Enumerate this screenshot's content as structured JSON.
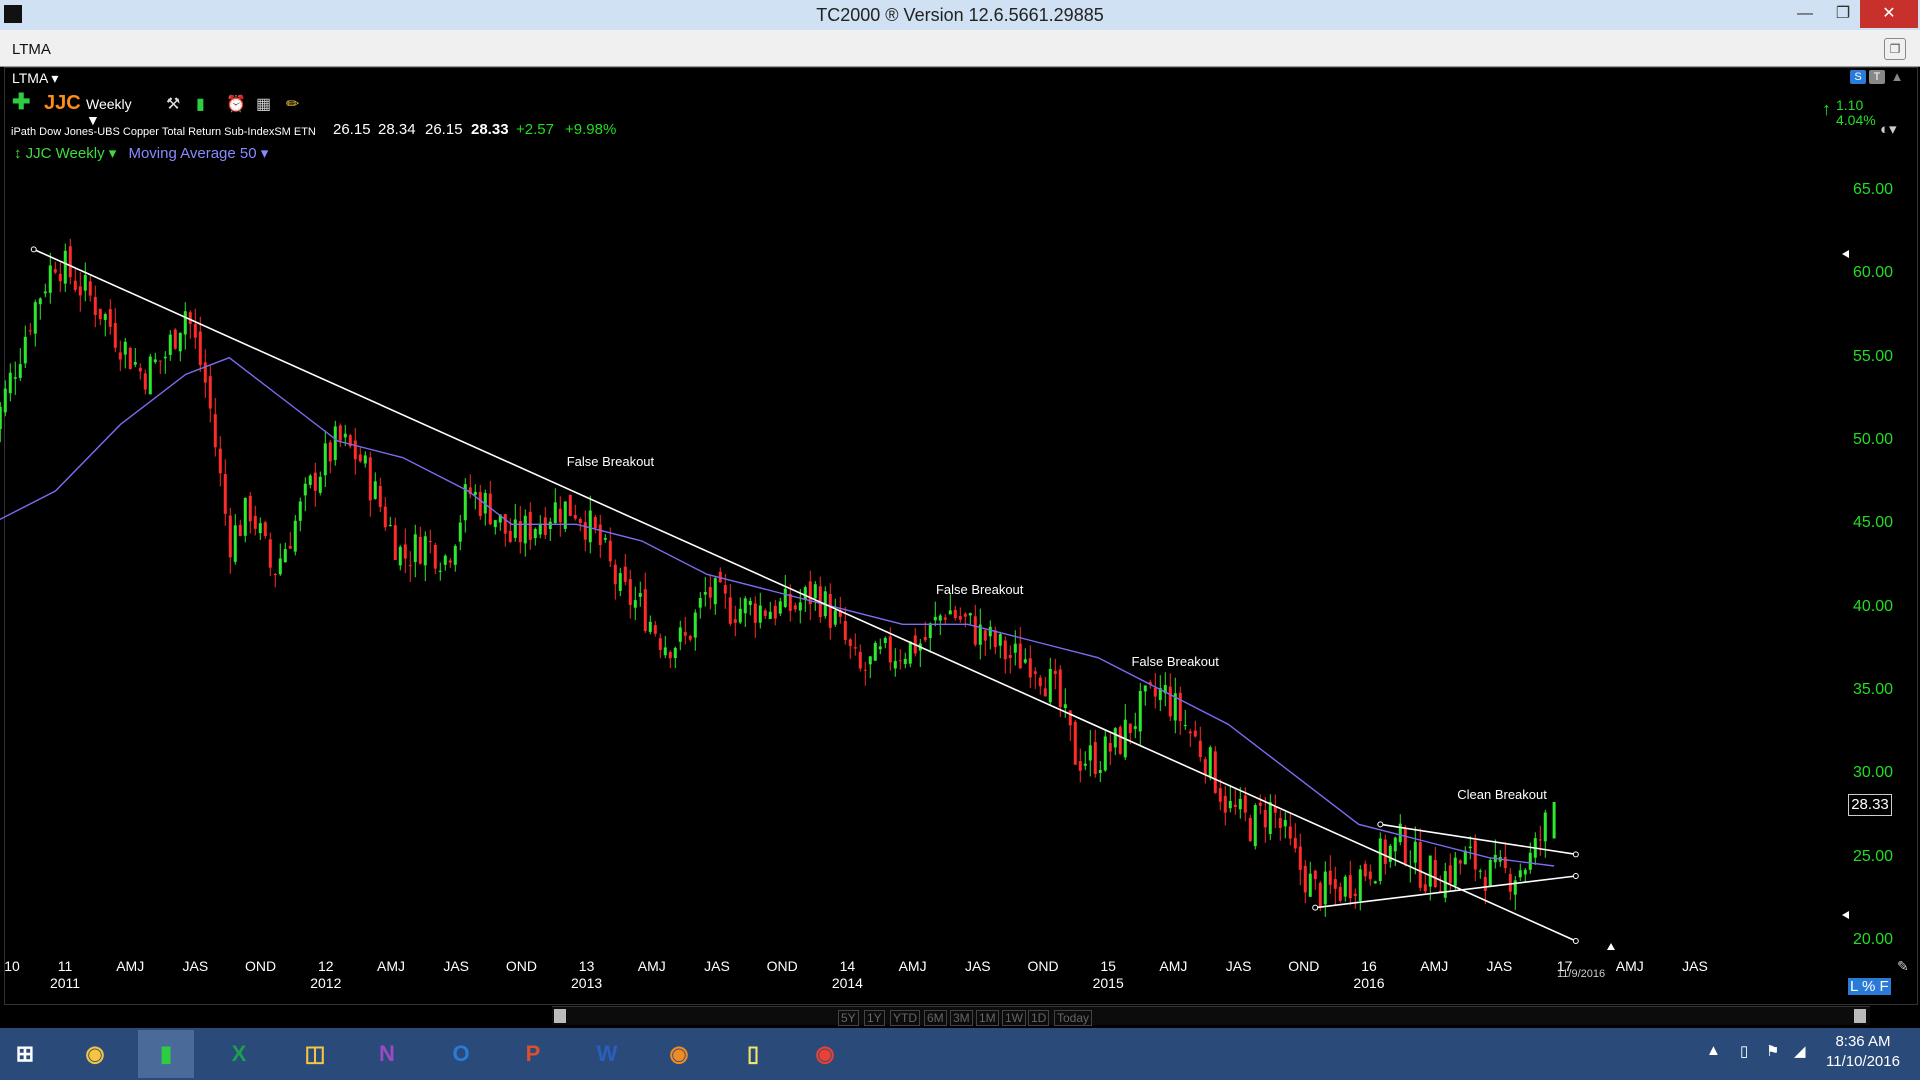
{
  "window": {
    "title": "TC2000 ® Version 12.6.5661.29885",
    "tab": "LTMA",
    "layout_name": "LTMA"
  },
  "toolbar": {
    "symbol": "JJC",
    "interval": "Weekly"
  },
  "security": {
    "name": "iPath Dow Jones-UBS Copper Total Return Sub-IndexSM ETN",
    "open": "26.15",
    "high": "28.34",
    "low": "26.15",
    "close": "28.33",
    "change": "+2.57",
    "change_pct": "+9.98%"
  },
  "legend": {
    "price_series": "JJC Weekly",
    "indicator": "Moving Average 50"
  },
  "right_info": {
    "line1": "1.10",
    "line2": "4.04%"
  },
  "right_toggles": [
    "S",
    "T"
  ],
  "scale_buttons": "L % F",
  "last_price_tag": "28.33",
  "date_stamp": "11/9/2016",
  "y_labels": [
    "65.00",
    "60.00",
    "55.00",
    "50.00",
    "45.00",
    "40.00",
    "35.00",
    "30.00",
    "25.00",
    "20.00"
  ],
  "x_labels": [
    {
      "t": "10",
      "s": ""
    },
    {
      "t": "11",
      "s": "2011"
    },
    {
      "t": "AMJ",
      "s": ""
    },
    {
      "t": "JAS",
      "s": ""
    },
    {
      "t": "OND",
      "s": ""
    },
    {
      "t": "12",
      "s": "2012"
    },
    {
      "t": "AMJ",
      "s": ""
    },
    {
      "t": "JAS",
      "s": ""
    },
    {
      "t": "OND",
      "s": ""
    },
    {
      "t": "13",
      "s": "2013"
    },
    {
      "t": "AMJ",
      "s": ""
    },
    {
      "t": "JAS",
      "s": ""
    },
    {
      "t": "OND",
      "s": ""
    },
    {
      "t": "14",
      "s": "2014"
    },
    {
      "t": "AMJ",
      "s": ""
    },
    {
      "t": "JAS",
      "s": ""
    },
    {
      "t": "OND",
      "s": ""
    },
    {
      "t": "15",
      "s": "2015"
    },
    {
      "t": "AMJ",
      "s": ""
    },
    {
      "t": "JAS",
      "s": ""
    },
    {
      "t": "OND",
      "s": ""
    },
    {
      "t": "16",
      "s": "2016"
    },
    {
      "t": "AMJ",
      "s": ""
    },
    {
      "t": "JAS",
      "s": ""
    },
    {
      "t": "17",
      "s": ""
    },
    {
      "t": "AMJ",
      "s": ""
    },
    {
      "t": "JAS",
      "s": ""
    }
  ],
  "annotations": [
    {
      "text": "False Breakout"
    },
    {
      "text": "False Breakout"
    },
    {
      "text": "False Breakout"
    },
    {
      "text": "Clean Breakout"
    }
  ],
  "timeframes": [
    "5Y",
    "1Y",
    "YTD",
    "6M",
    "3M",
    "1M",
    "1W",
    "1D",
    "Today"
  ],
  "chart_data": {
    "type": "candlestick",
    "series_name": "JJC Weekly",
    "indicator": "Moving Average 50",
    "ylim": [
      18.5,
      68
    ],
    "x_start": "2010-11",
    "x_end": "2017-10",
    "close_path": [
      {
        "date": "2010-11",
        "price": 50
      },
      {
        "date": "2011-01",
        "price": 58
      },
      {
        "date": "2011-02",
        "price": 61
      },
      {
        "date": "2011-04",
        "price": 58
      },
      {
        "date": "2011-06",
        "price": 54
      },
      {
        "date": "2011-07",
        "price": 55
      },
      {
        "date": "2011-08",
        "price": 58
      },
      {
        "date": "2011-09",
        "price": 53
      },
      {
        "date": "2011-10",
        "price": 44
      },
      {
        "date": "2011-11",
        "price": 46
      },
      {
        "date": "2011-12",
        "price": 42
      },
      {
        "date": "2012-02",
        "price": 48
      },
      {
        "date": "2012-03",
        "price": 50
      },
      {
        "date": "2012-04",
        "price": 49
      },
      {
        "date": "2012-05",
        "price": 46
      },
      {
        "date": "2012-06",
        "price": 43
      },
      {
        "date": "2012-07",
        "price": 44
      },
      {
        "date": "2012-08",
        "price": 43
      },
      {
        "date": "2012-09",
        "price": 47
      },
      {
        "date": "2012-10",
        "price": 46
      },
      {
        "date": "2012-11",
        "price": 44
      },
      {
        "date": "2013-01",
        "price": 46
      },
      {
        "date": "2013-02",
        "price": 46
      },
      {
        "date": "2013-03",
        "price": 44
      },
      {
        "date": "2013-04",
        "price": 41
      },
      {
        "date": "2013-05",
        "price": 40
      },
      {
        "date": "2013-06",
        "price": 38
      },
      {
        "date": "2013-07",
        "price": 38
      },
      {
        "date": "2013-08",
        "price": 41
      },
      {
        "date": "2013-09",
        "price": 40
      },
      {
        "date": "2013-10",
        "price": 40
      },
      {
        "date": "2013-12",
        "price": 40
      },
      {
        "date": "2014-01",
        "price": 41
      },
      {
        "date": "2014-02",
        "price": 39
      },
      {
        "date": "2014-03",
        "price": 36
      },
      {
        "date": "2014-04",
        "price": 37
      },
      {
        "date": "2014-06",
        "price": 38
      },
      {
        "date": "2014-07",
        "price": 40
      },
      {
        "date": "2014-08",
        "price": 39
      },
      {
        "date": "2014-09",
        "price": 38
      },
      {
        "date": "2014-10",
        "price": 37
      },
      {
        "date": "2014-11",
        "price": 37
      },
      {
        "date": "2014-12",
        "price": 35
      },
      {
        "date": "2015-01",
        "price": 31
      },
      {
        "date": "2015-02",
        "price": 31
      },
      {
        "date": "2015-03",
        "price": 32
      },
      {
        "date": "2015-04",
        "price": 34
      },
      {
        "date": "2015-05",
        "price": 35
      },
      {
        "date": "2015-06",
        "price": 33
      },
      {
        "date": "2015-07",
        "price": 31
      },
      {
        "date": "2015-08",
        "price": 28
      },
      {
        "date": "2015-09",
        "price": 27
      },
      {
        "date": "2015-10",
        "price": 28
      },
      {
        "date": "2015-11",
        "price": 25
      },
      {
        "date": "2015-12",
        "price": 23
      },
      {
        "date": "2016-01",
        "price": 23
      },
      {
        "date": "2016-02",
        "price": 24
      },
      {
        "date": "2016-03",
        "price": 25
      },
      {
        "date": "2016-04",
        "price": 26
      },
      {
        "date": "2016-05",
        "price": 24
      },
      {
        "date": "2016-06",
        "price": 24
      },
      {
        "date": "2016-07",
        "price": 25
      },
      {
        "date": "2016-08",
        "price": 24
      },
      {
        "date": "2016-09",
        "price": 24
      },
      {
        "date": "2016-10",
        "price": 25
      },
      {
        "date": "2016-11",
        "price": 28.33
      }
    ],
    "moving_average_path": [
      {
        "date": "2010-11",
        "price": 45
      },
      {
        "date": "2011-02",
        "price": 47
      },
      {
        "date": "2011-05",
        "price": 51
      },
      {
        "date": "2011-08",
        "price": 54
      },
      {
        "date": "2011-10",
        "price": 55
      },
      {
        "date": "2011-12",
        "price": 53
      },
      {
        "date": "2012-03",
        "price": 50
      },
      {
        "date": "2012-06",
        "price": 49
      },
      {
        "date": "2012-09",
        "price": 47
      },
      {
        "date": "2012-11",
        "price": 45
      },
      {
        "date": "2013-02",
        "price": 45
      },
      {
        "date": "2013-05",
        "price": 44
      },
      {
        "date": "2013-08",
        "price": 42
      },
      {
        "date": "2013-11",
        "price": 41
      },
      {
        "date": "2014-02",
        "price": 40
      },
      {
        "date": "2014-05",
        "price": 39
      },
      {
        "date": "2014-08",
        "price": 39
      },
      {
        "date": "2014-11",
        "price": 38
      },
      {
        "date": "2015-02",
        "price": 37
      },
      {
        "date": "2015-05",
        "price": 35
      },
      {
        "date": "2015-08",
        "price": 33
      },
      {
        "date": "2015-11",
        "price": 30
      },
      {
        "date": "2016-02",
        "price": 27
      },
      {
        "date": "2016-05",
        "price": 26
      },
      {
        "date": "2016-08",
        "price": 25
      },
      {
        "date": "2016-11",
        "price": 24.5
      }
    ],
    "trend_lines": [
      {
        "from": {
          "date": "2011-01",
          "price": 61.5
        },
        "to": {
          "date": "2016-12",
          "price": 20
        }
      },
      {
        "from": {
          "date": "2016-03",
          "price": 27
        },
        "to": {
          "date": "2016-12",
          "price": 25.2
        }
      },
      {
        "from": {
          "date": "2015-12",
          "price": 22
        },
        "to": {
          "date": "2016-12",
          "price": 23.9
        }
      }
    ],
    "annotation_points": [
      {
        "text": "False Breakout",
        "date": "2013-02",
        "price": 48.5
      },
      {
        "text": "False Breakout",
        "date": "2014-07",
        "price": 40.8
      },
      {
        "text": "False Breakout",
        "date": "2015-04",
        "price": 36.5
      },
      {
        "text": "Clean Breakout",
        "date": "2016-07",
        "price": 28.5
      }
    ]
  }
}
